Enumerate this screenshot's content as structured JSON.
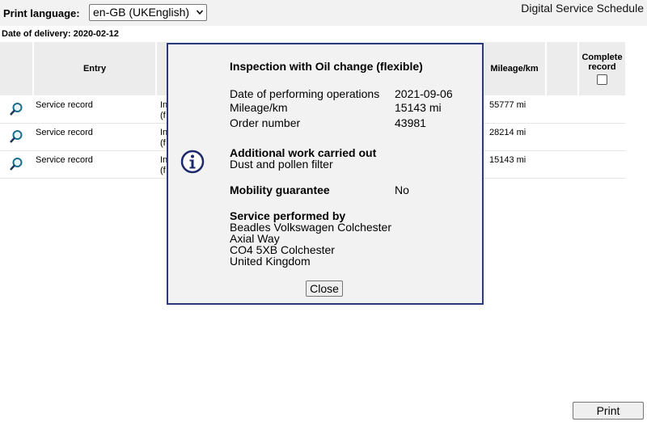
{
  "header": {
    "print_language_label": "Print language:",
    "language_selected": "en-GB (UKEnglish)",
    "app_title": "Digital Service Schedule"
  },
  "delivery": {
    "text": "Date of delivery: 2020-02-12"
  },
  "table": {
    "columns": {
      "entry": "Entry",
      "mileage": "Mileage/km",
      "complete_line1": "Complete",
      "complete_line2": "record"
    },
    "rows": [
      {
        "entry": "Service record",
        "desc1": "In",
        "desc2": "(f",
        "mileage": "55777 mi"
      },
      {
        "entry": "Service record",
        "desc1": "In",
        "desc2": "(f",
        "mileage": "28214 mi"
      },
      {
        "entry": "Service record",
        "desc1": "In",
        "desc2": "(f",
        "mileage": "15143 mi"
      }
    ]
  },
  "modal": {
    "title": "Inspection with Oil change (flexible)",
    "date_label": "Date of performing operations",
    "date_value": "2021-09-06",
    "mileage_label": "Mileage/km",
    "mileage_value": "15143 mi",
    "order_label": "Order number",
    "order_value": "43981",
    "additional_title": "Additional work carried out",
    "additional_value": "Dust and pollen filter",
    "mobility_label": "Mobility guarantee",
    "mobility_value": "No",
    "service_title": "Service performed by",
    "address": [
      "Beadles Volkswagen Colchester",
      "Axial Way",
      "CO4 5XB Colchester",
      "United Kingdom"
    ],
    "close_label": "Close",
    "icon": "info-icon"
  },
  "footer": {
    "print_label": "Print"
  }
}
